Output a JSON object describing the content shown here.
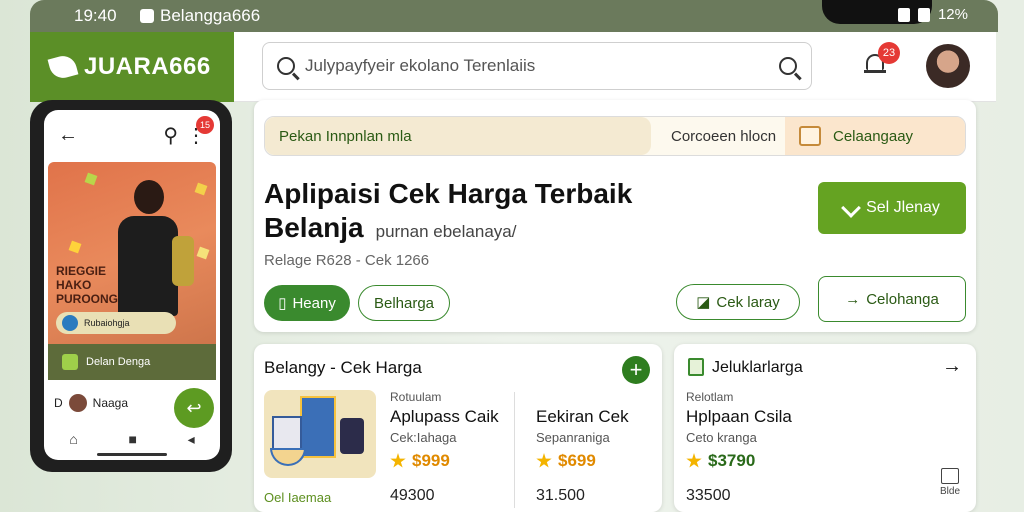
{
  "statusbar": {
    "time": "19:40",
    "app": "Belangga666",
    "battery": "12%"
  },
  "brand": {
    "name": "JUARA666"
  },
  "search": {
    "placeholder": "Julypayfyeir ekolano Terenlaiis"
  },
  "notifications": {
    "count": "23"
  },
  "phone": {
    "badge": "15",
    "hero_text_1": "Rieggie",
    "hero_text_2": "HAKO",
    "hero_text_3": "Puroong",
    "strip_text": "Rubaiohgja",
    "bar_text": "Delan Denga",
    "row_label": "Naaga",
    "row_letter": "D",
    "fab": "↩"
  },
  "promo": {
    "left": "Pekan Innpnlan mla",
    "mid": "Corcoeen hlocn",
    "right": "Celaangaay"
  },
  "hero": {
    "title": "Aplipaisi Cek Harga Terbaik",
    "title2": "Belanja",
    "subtitle": "purnan ebelanaya/",
    "meta": "Relage R628 - Cek 1266",
    "btn_primary": "Heany",
    "btn_secondary": "Belharga",
    "cta": "Sel Jlenay",
    "btn_cek": "Cek laray",
    "btn_cel": "Celohanga"
  },
  "card_left": {
    "title": "Belangy - Cek Harga",
    "green_label": "Oel Iaemaa",
    "col1": {
      "label": "Rotuulam",
      "name": "Aplupass Caik",
      "sub": "Cek:Iahaga",
      "price": "$999",
      "num": "49300"
    },
    "col2": {
      "label": "",
      "name": "Eekiran Cek",
      "sub": "Sepanraniga",
      "price": "$699",
      "num": "31.500"
    }
  },
  "card_right": {
    "title": "Jeluklarlarga",
    "label": "Relotlam",
    "name": "Hplpaan Csila",
    "sub": "Ceto kranga",
    "price": "$3790",
    "num": "33500",
    "corner": "Blde"
  }
}
